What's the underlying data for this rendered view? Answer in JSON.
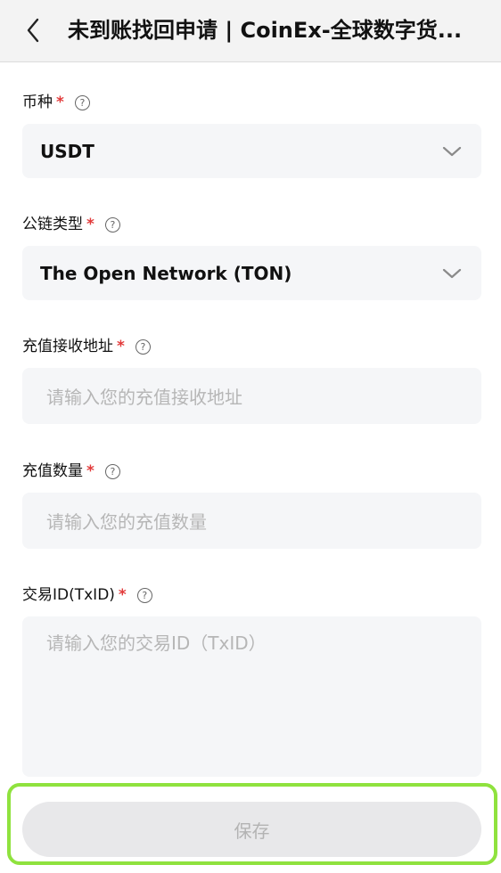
{
  "header": {
    "title": "未到账找回申请 | CoinEx-全球数字货..."
  },
  "form": {
    "coin": {
      "label": "币种",
      "required_mark": "*",
      "help": "?",
      "value": "USDT"
    },
    "chain": {
      "label": "公链类型",
      "required_mark": "*",
      "help": "?",
      "value": "The Open Network (TON)"
    },
    "address": {
      "label": "充值接收地址",
      "required_mark": "*",
      "help": "?",
      "placeholder": "请输入您的充值接收地址"
    },
    "amount": {
      "label": "充值数量",
      "required_mark": "*",
      "help": "?",
      "placeholder": "请输入您的充值数量"
    },
    "txid": {
      "label": "交易ID(TxID)",
      "required_mark": "*",
      "help": "?",
      "placeholder": "请输入您的交易ID（TxID）"
    }
  },
  "footer": {
    "save_label": "保存"
  },
  "colors": {
    "required": "#e23b3b",
    "highlight": "#8fe23e",
    "input_bg": "#f5f6f8",
    "button_bg": "#e8e8ea"
  }
}
